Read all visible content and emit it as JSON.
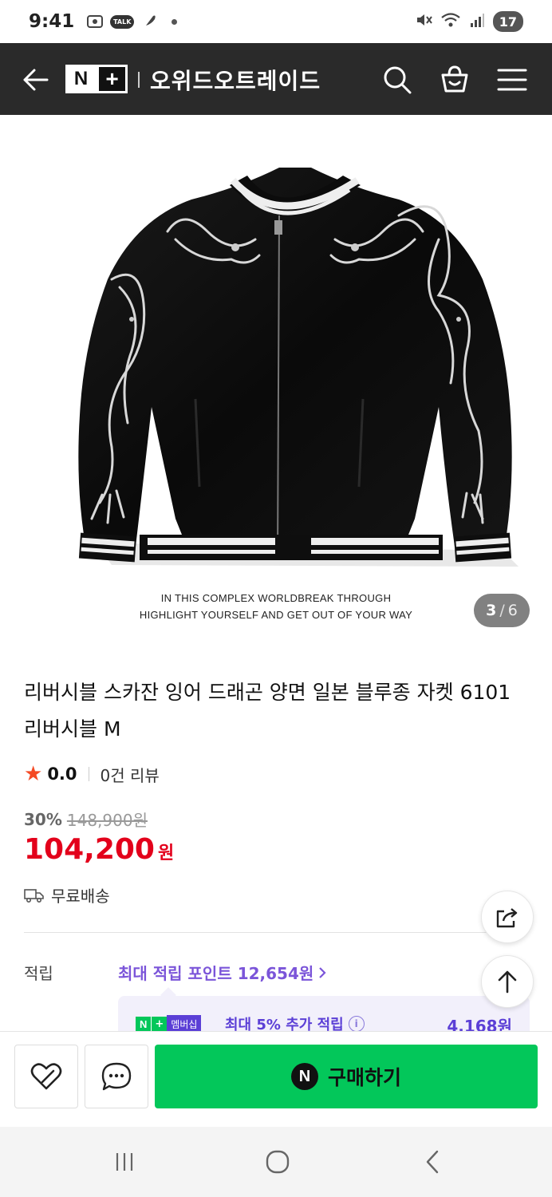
{
  "status_bar": {
    "time": "9:41",
    "talk_label": "TALK",
    "battery": "17"
  },
  "header": {
    "logo_n": "N",
    "logo_plus": "+",
    "store_name": "오위드오트레이드",
    "icons": [
      "back-arrow-icon",
      "search-icon",
      "cart-icon",
      "menu-icon"
    ],
    "background_color": "#2a2a2a"
  },
  "gallery": {
    "tagline_line1": "IN THIS COMPLEX WORLDBREAK THROUGH",
    "tagline_line2": "HIGHLIGHT YOURSELF AND GET OUT OF YOUR WAY",
    "current": "3",
    "separator": "/",
    "total": "6"
  },
  "product": {
    "title": "리버시블 스카잔 잉어 드래곤 양면 일본 블루종 자켓 6101 리버시블 M",
    "rating": "0.0",
    "reviews": "0건 리뷰",
    "discount": "30%",
    "original_price": "148,900원",
    "price": "104,200",
    "price_unit": "원",
    "shipping": "무료배송",
    "price_color": "#e3001b"
  },
  "points": {
    "label": "적립",
    "link_text": "최대 적립 포인트 12,654원",
    "member_badge_n": "N",
    "member_badge_plus": "+",
    "member_badge_text": "멤버십",
    "member_text": "최대 5% 추가 적립",
    "member_amount": "4,168원",
    "accent_color": "#7b55d9"
  },
  "actions": {
    "buy_icon_letter": "N",
    "buy_label": "구매하기",
    "buy_color": "#03c75a"
  }
}
